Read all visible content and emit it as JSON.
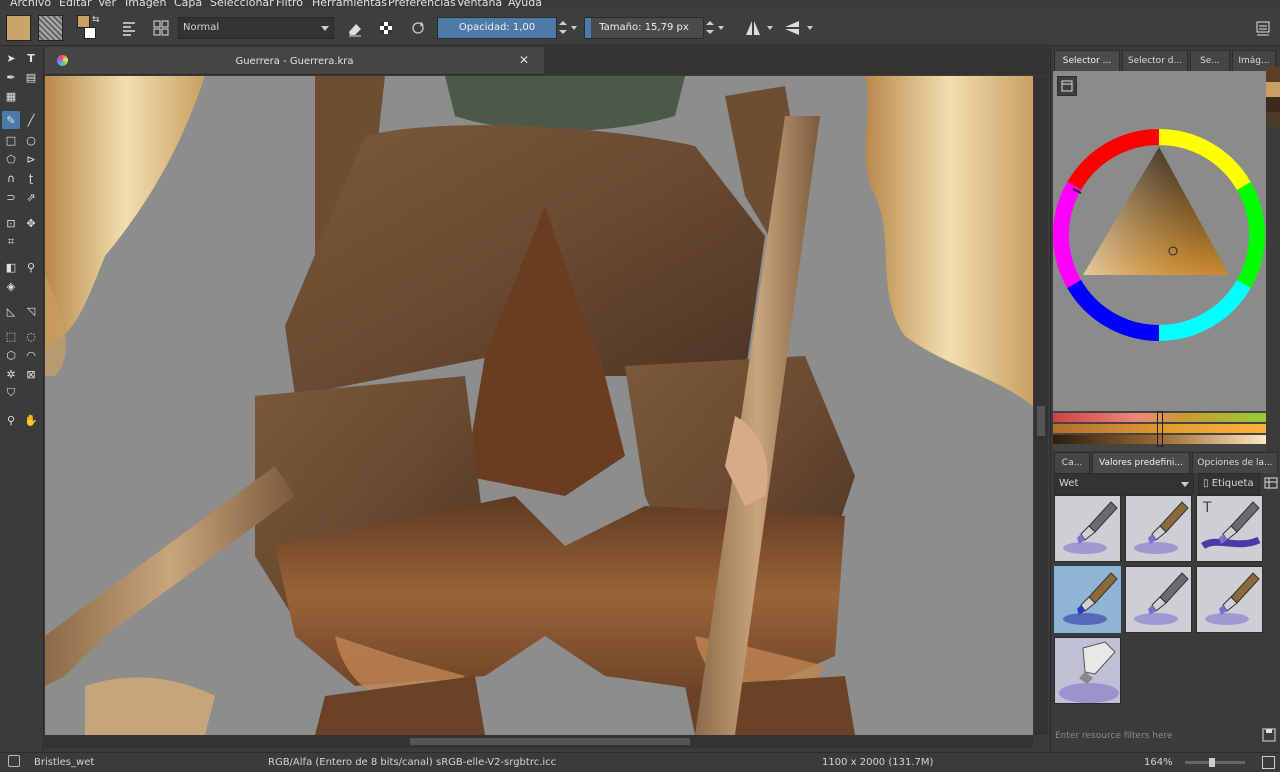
{
  "menu": {
    "items": [
      "Archivo",
      "Editar",
      "Ver",
      "Imagen",
      "Capa",
      "Seleccionar",
      "Filtro",
      "Herramientas",
      "Preferencias",
      "Ventana",
      "Ayuda"
    ]
  },
  "toolbar": {
    "blend_mode": "Normal",
    "opacity_label": "Opacidad:",
    "opacity_value": "1,00",
    "opacity_fraction": 1.0,
    "size_label": "Tamaño:",
    "size_value": "15,79 px",
    "size_fraction": 0.05,
    "foreground_color": "#c9a061",
    "background_color": "#ffffff"
  },
  "document": {
    "tab_title": "Guerrera - Guerrera.kra"
  },
  "dock": {
    "color_tabs": [
      "Selector ...",
      "Selector d...",
      "Se...",
      "Imág..."
    ],
    "preset_tabs": [
      "Ca...",
      "Valores predefini...",
      "Opciones de la..."
    ],
    "preset_filter": "Wet",
    "tag_label": "Etiqueta",
    "resource_filter_placeholder": "Enter resource filters here",
    "accent": "#4d7aa8"
  },
  "brushes": [
    {
      "name": "wet-brush-1",
      "selected": false
    },
    {
      "name": "wet-brush-2",
      "selected": false
    },
    {
      "name": "wet-brush-text",
      "selected": false
    },
    {
      "name": "wet-brush-bristles",
      "selected": true
    },
    {
      "name": "wet-brush-5",
      "selected": false
    },
    {
      "name": "wet-brush-6",
      "selected": false
    },
    {
      "name": "wet-tube",
      "selected": false
    }
  ],
  "status": {
    "brush_name": "Bristles_wet",
    "color_model": "RGB/Alfa (Entero de 8 bits/canal)  sRGB-elle-V2-srgbtrc.icc",
    "dimensions": "1100 x 2000 (131.7M)",
    "zoom": "164%",
    "zoom_fraction": 0.45
  }
}
